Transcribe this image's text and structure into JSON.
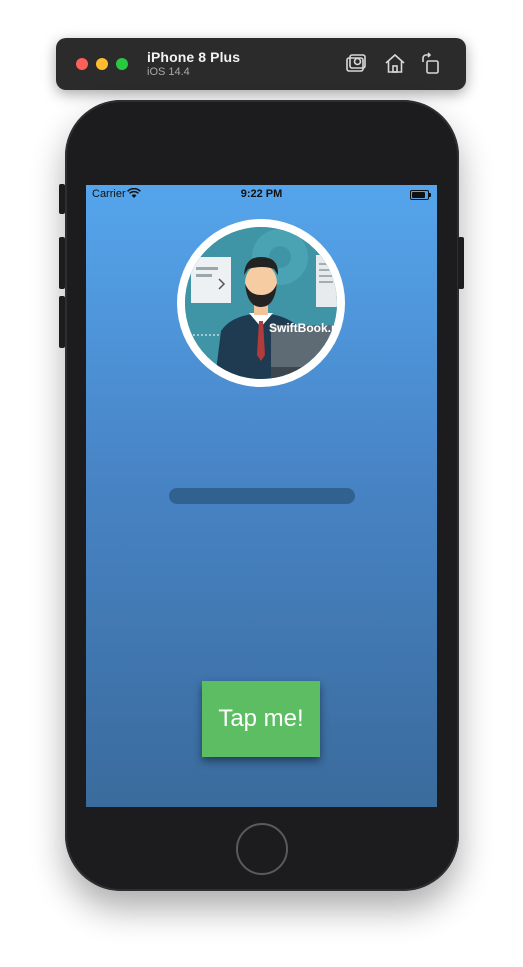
{
  "simulator": {
    "device_name": "iPhone 8 Plus",
    "os_version": "iOS 14.4",
    "toolbar_icons": [
      "screenshot-icon",
      "home-icon",
      "rotate-icon"
    ]
  },
  "status_bar": {
    "carrier": "Carrier",
    "time": "9:22 PM"
  },
  "avatar": {
    "caption": "SwiftBook.r"
  },
  "progress": {
    "value": 0
  },
  "tap_button": {
    "label": "Tap me!",
    "color": "#5cbd63"
  },
  "colors": {
    "gradient_top": "#55a5ec",
    "gradient_bottom": "#3a6b9c"
  }
}
